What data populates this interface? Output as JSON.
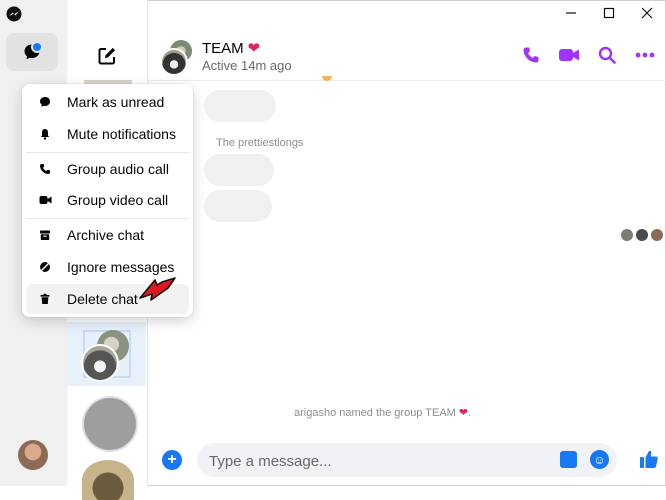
{
  "window": {
    "controls": [
      "minimize",
      "maximize",
      "close"
    ]
  },
  "header": {
    "title": "TEAM",
    "title_emoji": "❤",
    "status": "Active 14m ago"
  },
  "messages": {
    "sender_name": "The prettiestlongs",
    "system_text": "arigasho named the group TEAM",
    "system_emoji": "❤",
    "system_suffix": "."
  },
  "composer": {
    "placeholder": "Type a message..."
  },
  "context_menu": {
    "items": [
      {
        "label": "Mark as unread",
        "icon": "message-bubble-icon"
      },
      {
        "label": "Mute notifications",
        "icon": "bell-icon"
      },
      {
        "label": "Group audio call",
        "icon": "phone-icon"
      },
      {
        "label": "Group video call",
        "icon": "video-camera-icon"
      },
      {
        "label": "Archive chat",
        "icon": "archive-box-icon"
      },
      {
        "label": "Ignore messages",
        "icon": "ignore-icon"
      },
      {
        "label": "Delete chat",
        "icon": "trash-icon"
      }
    ]
  },
  "colors": {
    "accent_purple": "#a033ff",
    "accent_blue": "#1877f2",
    "annotation_arrow": "#e0191f"
  }
}
